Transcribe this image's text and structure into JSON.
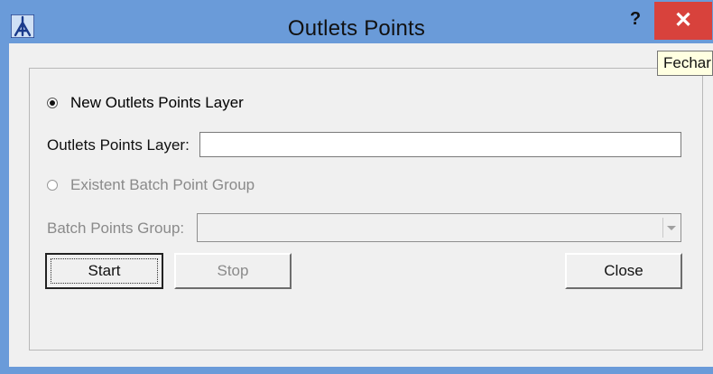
{
  "window": {
    "title": "Outlets Points",
    "help_label": "?",
    "close_label": "✕",
    "close_tooltip": "Fechar",
    "app_icon": "app-logo-icon"
  },
  "form": {
    "new_layer_radio": {
      "label": "New Outlets Points Layer",
      "checked": true
    },
    "outlets_layer": {
      "label": "Outlets Points Layer:",
      "value": ""
    },
    "existent_group_radio": {
      "label": "Existent Batch Point Group",
      "checked": false,
      "disabled": true
    },
    "batch_group": {
      "label": "Batch Points Group:",
      "value": "",
      "disabled": true
    }
  },
  "buttons": {
    "start": "Start",
    "stop": "Stop",
    "close": "Close"
  },
  "colors": {
    "titlebar": "#6a9bd9",
    "close_button": "#d8423c",
    "client": "#f0f0f0",
    "tooltip": "#ffffe1"
  }
}
